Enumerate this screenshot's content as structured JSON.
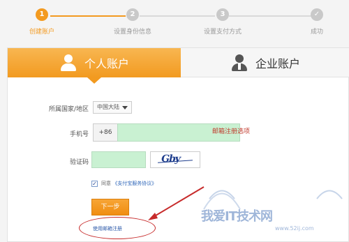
{
  "steps": [
    {
      "index": "1",
      "label": "创建账户"
    },
    {
      "index": "2",
      "label": "设置身份信息"
    },
    {
      "index": "3",
      "label": "设置支付方式"
    },
    {
      "index": "✓",
      "label": "成功"
    }
  ],
  "tabs": {
    "personal": "个人账户",
    "business": "企业账户"
  },
  "form": {
    "country_label": "所属国家/地区",
    "country_value": "中国大陆",
    "phone_label": "手机号",
    "phone_prefix": "+86",
    "code_label": "验证码",
    "captcha_text": "Gby",
    "agree_text": "同意",
    "agreement_link": "《支付宝服务协议》",
    "next_button": "下一步",
    "email_register_link": "使用邮箱注册"
  },
  "annotation": "邮箱注册选项",
  "watermark": {
    "main": "我爱IT技术网",
    "sub": "www.52ij.com"
  },
  "colors": {
    "accent": "#f39a1f",
    "input_green": "#c9f1d2",
    "annotation_red": "#c0392b"
  }
}
